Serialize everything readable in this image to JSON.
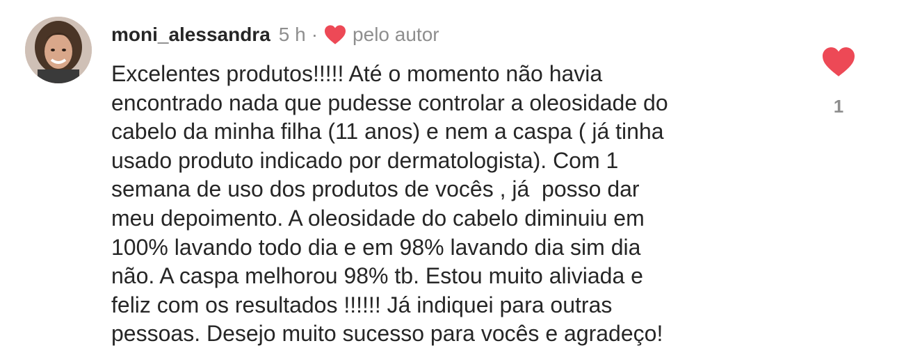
{
  "comment": {
    "username": "moni_alessandra",
    "time": "5 h",
    "separator": "·",
    "author_like_label": "pelo autor",
    "text": "Excelentes produtos!!!!! Até o momento não havia\nencontrado nada que pudesse controlar a oleosidade do\ncabelo da minha filha (11 anos) e nem a caspa ( já tinha\nusado produto indicado por dermatologista). Com 1\nsemana de uso dos produtos de vocês , já  posso dar\nmeu depoimento. A oleosidade do cabelo diminuiu em\n100% lavando todo dia e em 98% lavando dia sim dia\nnão. A caspa melhorou 98% tb. Estou muito aliviada e\nfeliz com os resultados !!!!!! Já indiquei para outras\npessoas. Desejo muito sucesso para vocês e agradeço!",
    "like_count": "1"
  },
  "icons": {
    "author_heart": "heart-icon",
    "like": "heart-icon"
  },
  "colors": {
    "heart_red": "#ed4956",
    "username": "#262626",
    "meta_gray": "#8e8e8e",
    "text": "#262626"
  }
}
